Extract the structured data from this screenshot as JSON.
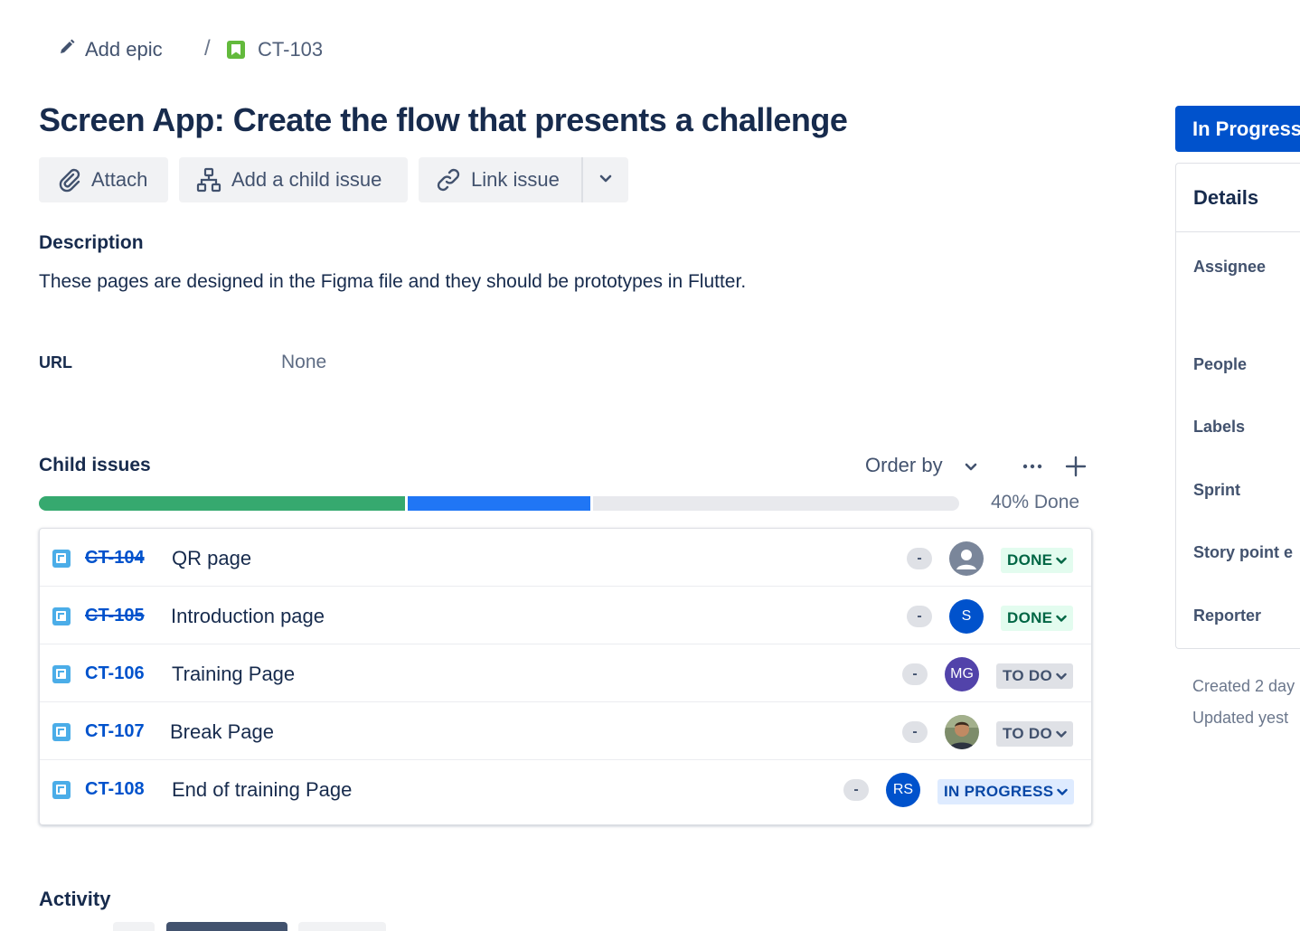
{
  "breadcrumb": {
    "add_epic_label": "Add epic",
    "separator": "/",
    "issue_key": "CT-103"
  },
  "issue": {
    "title": "Screen App: Create the flow that presents a challenge"
  },
  "toolbar": {
    "attach_label": "Attach",
    "add_child_label": "Add a child issue",
    "link_issue_label": "Link issue"
  },
  "description": {
    "heading": "Description",
    "text": "These pages are designed in the Figma file and they should be prototypes in Flutter."
  },
  "url_field": {
    "label": "URL",
    "value": "None"
  },
  "child_issues": {
    "heading": "Child issues",
    "order_by_label": "Order by",
    "progress": {
      "done_fraction": 0.4,
      "in_progress_fraction": 0.2,
      "todo_fraction": 0.4
    },
    "progress_label": "40% Done",
    "colors": {
      "done": "#36a96f",
      "in_progress": "#2076f5",
      "todo": "#e8e9ed"
    },
    "rows": [
      {
        "key": "CT-104",
        "summary": "QR page",
        "estimate": "-",
        "assignee": {
          "initials": "",
          "kind": "unassigned-avatar"
        },
        "status": "DONE"
      },
      {
        "key": "CT-105",
        "summary": "Introduction page",
        "estimate": "-",
        "assignee": {
          "initials": "S",
          "color": "#0052cc"
        },
        "status": "DONE"
      },
      {
        "key": "CT-106",
        "summary": "Training Page",
        "estimate": "-",
        "assignee": {
          "initials": "MG",
          "color": "#5243aa"
        },
        "status": "TO DO"
      },
      {
        "key": "CT-107",
        "summary": "Break Page",
        "estimate": "-",
        "assignee": {
          "initials": "",
          "kind": "photo-avatar"
        },
        "status": "TO DO"
      },
      {
        "key": "CT-108",
        "summary": "End of training Page",
        "estimate": "-",
        "assignee": {
          "initials": "RS",
          "color": "#0052cc"
        },
        "status": "IN PROGRESS"
      }
    ]
  },
  "activity": {
    "heading": "Activity"
  },
  "sidebar": {
    "status_button_label": "In Progress",
    "details_heading": "Details",
    "fields": [
      "Assignee",
      "People",
      "Labels",
      "Sprint",
      "Story point e",
      "Reporter"
    ],
    "created_text": "Created 2 day",
    "updated_text": "Updated yest"
  }
}
